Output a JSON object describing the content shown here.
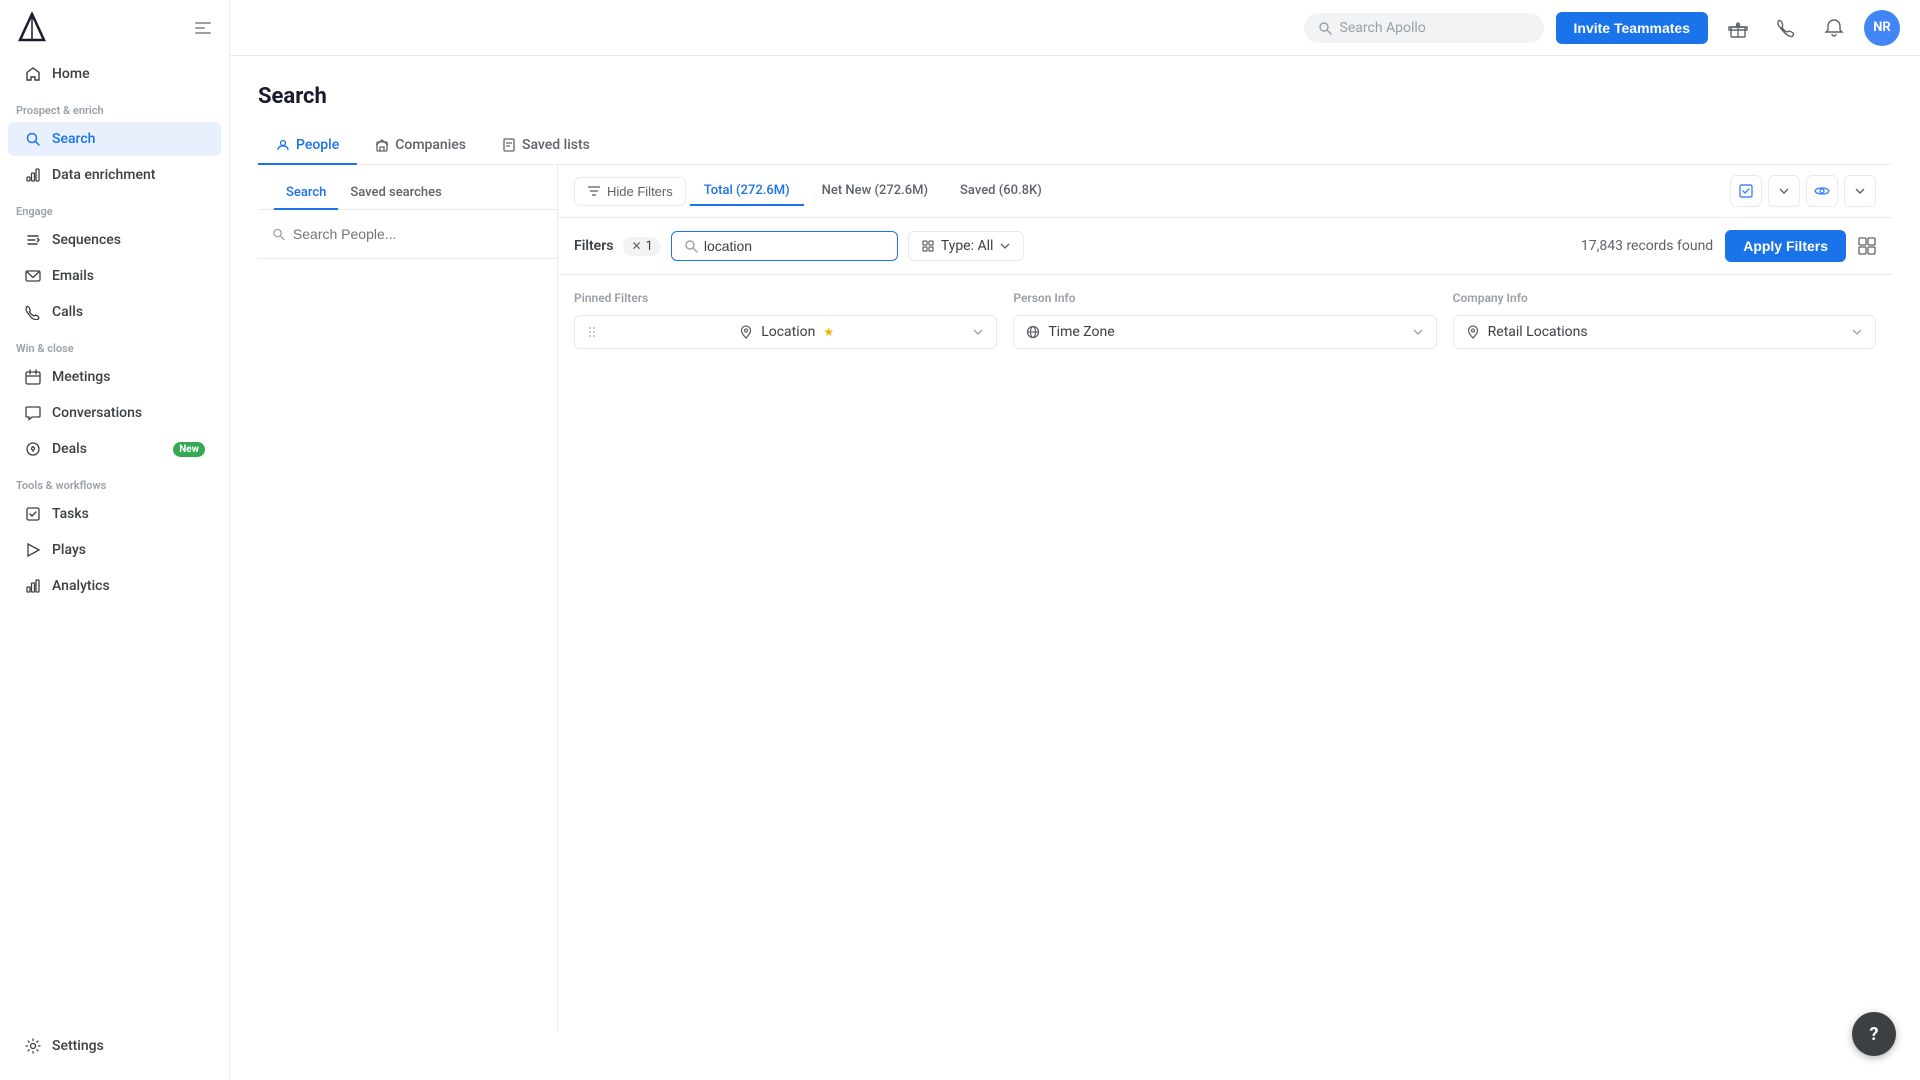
{
  "sidebar": {
    "logo_alt": "Apollo Logo",
    "toggle_icon": "sidebar-toggle",
    "sections": [
      {
        "label": "",
        "items": [
          {
            "id": "home",
            "label": "Home",
            "icon": "home",
            "active": false
          }
        ]
      },
      {
        "label": "Prospect & enrich",
        "items": [
          {
            "id": "search",
            "label": "Search",
            "icon": "search",
            "active": true
          },
          {
            "id": "data-enrichment",
            "label": "Data enrichment",
            "icon": "data-enrichment",
            "active": false
          }
        ]
      },
      {
        "label": "Engage",
        "items": [
          {
            "id": "sequences",
            "label": "Sequences",
            "icon": "sequences",
            "active": false
          },
          {
            "id": "emails",
            "label": "Emails",
            "icon": "emails",
            "active": false
          },
          {
            "id": "calls",
            "label": "Calls",
            "icon": "calls",
            "active": false
          }
        ]
      },
      {
        "label": "Win & close",
        "items": [
          {
            "id": "meetings",
            "label": "Meetings",
            "icon": "meetings",
            "active": false
          },
          {
            "id": "conversations",
            "label": "Conversations",
            "icon": "conversations",
            "active": false
          },
          {
            "id": "deals",
            "label": "Deals",
            "icon": "deals",
            "active": false,
            "badge": "New"
          }
        ]
      },
      {
        "label": "Tools & workflows",
        "items": [
          {
            "id": "tasks",
            "label": "Tasks",
            "icon": "tasks",
            "active": false
          },
          {
            "id": "plays",
            "label": "Plays",
            "icon": "plays",
            "active": false
          },
          {
            "id": "analytics",
            "label": "Analytics",
            "icon": "analytics",
            "active": false
          }
        ]
      }
    ],
    "bottom_items": [
      {
        "id": "settings",
        "label": "Settings",
        "icon": "settings",
        "active": false
      }
    ]
  },
  "topbar": {
    "search_placeholder": "Search Apollo",
    "invite_button": "Invite Teammates",
    "avatar_initials": "NR"
  },
  "page": {
    "title": "Search",
    "tabs": [
      {
        "id": "people",
        "label": "People",
        "active": true
      },
      {
        "id": "companies",
        "label": "Companies",
        "active": false
      },
      {
        "id": "saved-lists",
        "label": "Saved lists",
        "active": false
      }
    ]
  },
  "left_panel": {
    "tabs": [
      {
        "id": "search",
        "label": "Search",
        "active": true
      },
      {
        "id": "saved-searches",
        "label": "Saved searches",
        "active": false
      }
    ],
    "search_placeholder": "Search People..."
  },
  "filter_bar": {
    "label": "Filters",
    "count": "1",
    "search_value": "location",
    "type_dropdown": "Type: All",
    "records_count": "17,843 records found",
    "apply_button": "Apply Filters"
  },
  "results_bar": {
    "hide_filters_label": "Hide Filters",
    "tabs": [
      {
        "id": "total",
        "label": "Total (272.6M)",
        "active": true
      },
      {
        "id": "net-new",
        "label": "Net New (272.6M)",
        "active": false
      },
      {
        "id": "saved",
        "label": "Saved (60.8K)",
        "active": false
      }
    ]
  },
  "filter_sections": {
    "pinned": {
      "title": "Pinned Filters",
      "items": [
        {
          "id": "location",
          "label": "Location",
          "icon": "location-pin",
          "pinned": true
        }
      ]
    },
    "person_info": {
      "title": "Person Info",
      "items": [
        {
          "id": "timezone",
          "label": "Time Zone",
          "icon": "globe"
        }
      ]
    },
    "company_info": {
      "title": "Company Info",
      "items": [
        {
          "id": "retail-locations",
          "label": "Retail Locations",
          "icon": "location-pin"
        }
      ]
    }
  },
  "help_button": "?"
}
